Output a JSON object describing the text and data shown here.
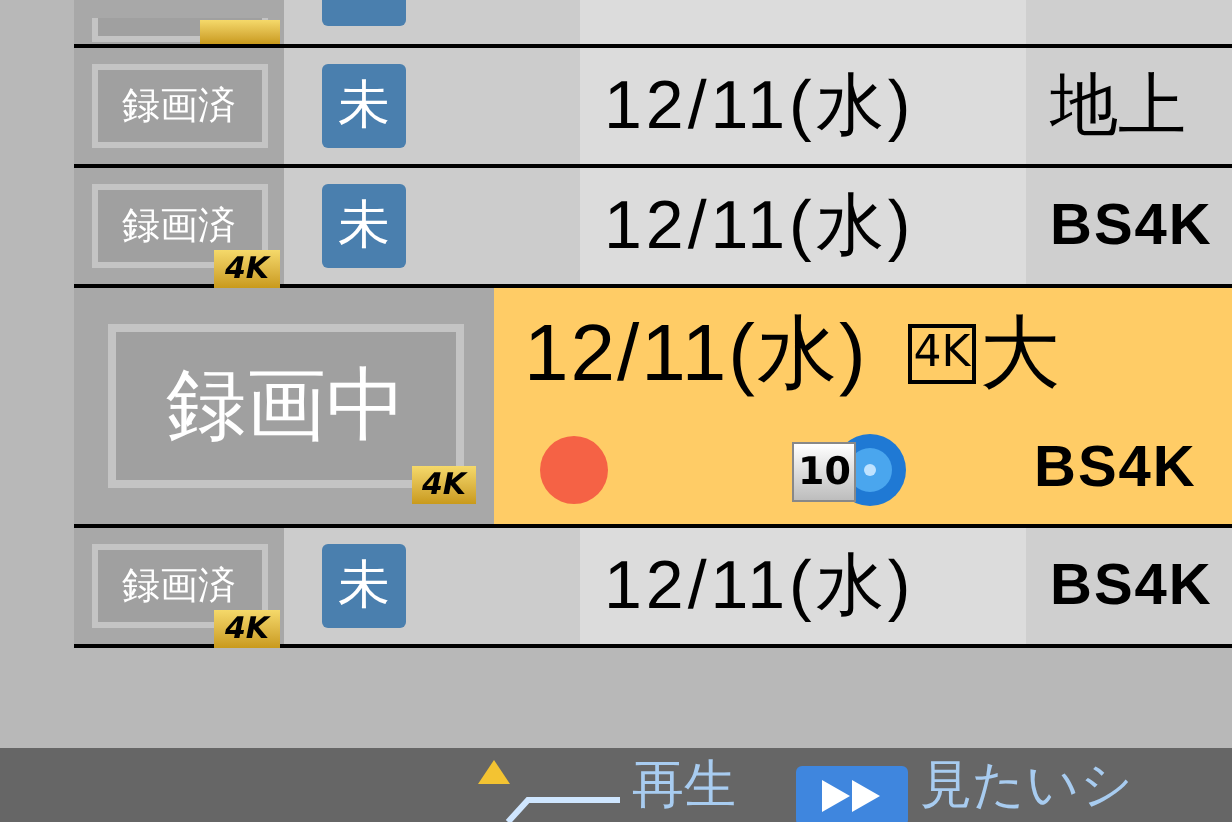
{
  "rows": [
    {
      "kind": "recorded",
      "status": "録画済",
      "unwatched": "未",
      "date": "12/11(水)",
      "channel": "地上",
      "selected": false
    },
    {
      "kind": "recorded",
      "status": "録画済",
      "badge": "4K",
      "unwatched": "未",
      "date": "12/11(水)",
      "channel": "BS4K",
      "selected": false
    },
    {
      "kind": "recording",
      "status": "録画中",
      "badge": "4K",
      "date": "12/11(水)",
      "title_mark": "4K",
      "title": "大",
      "recording": true,
      "disc": "10",
      "channel": "BS4K",
      "selected": true
    },
    {
      "kind": "recorded",
      "status": "録画済",
      "badge": "4K",
      "unwatched": "未",
      "date": "12/11(水)",
      "channel": "BS4K",
      "selected": false
    }
  ],
  "footer": {
    "play_label": "再生",
    "ff_label": "見たいシ"
  }
}
